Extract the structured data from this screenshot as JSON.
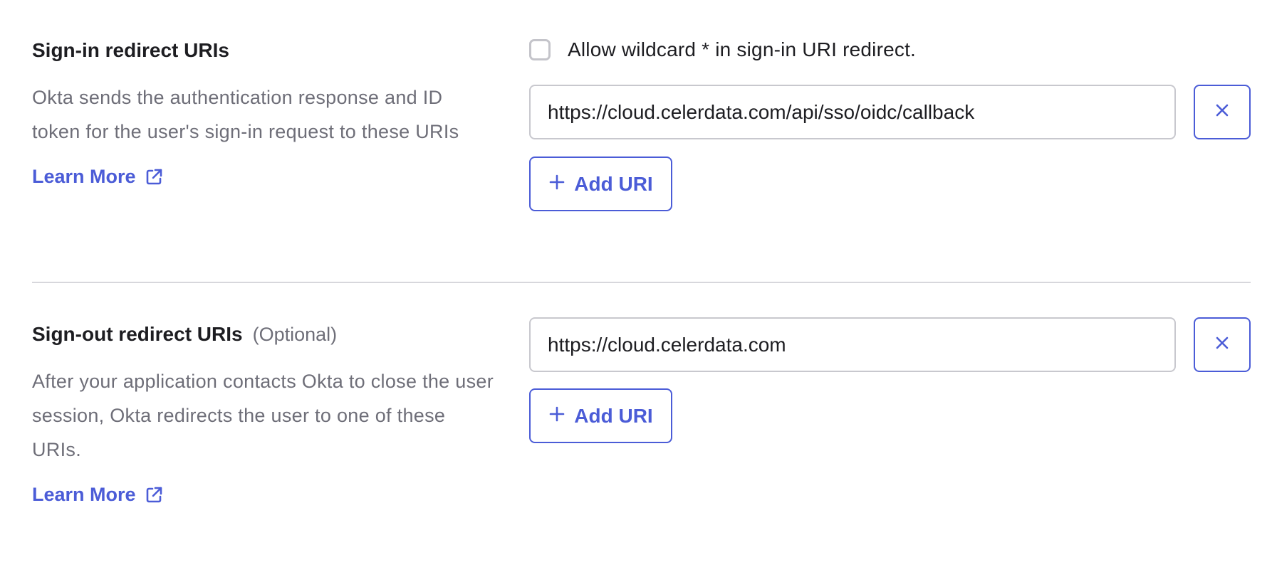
{
  "colors": {
    "accent": "#4b5cd7",
    "text_primary": "#1d1d21",
    "text_secondary": "#6e6e78",
    "border": "#c8c8ce",
    "divider": "#d7d7dc"
  },
  "signin": {
    "title": "Sign-in redirect URIs",
    "description": "Okta sends the authentication response and ID token for the user's sign-in request to these URIs",
    "learn_more": "Learn More",
    "learn_more_icon": "external-link-icon",
    "wildcard_checked": false,
    "wildcard_label": "Allow wildcard * in sign-in URI redirect.",
    "uris": [
      "https://cloud.celerdata.com/api/sso/oidc/callback"
    ],
    "remove_icon": "close-icon",
    "add_label": "Add URI",
    "add_icon": "plus-icon"
  },
  "signout": {
    "title": "Sign-out redirect URIs",
    "optional": "(Optional)",
    "description": "After your application contacts Okta to close the user session, Okta redirects the user to one of these URIs.",
    "learn_more": "Learn More",
    "learn_more_icon": "external-link-icon",
    "uris": [
      "https://cloud.celerdata.com"
    ],
    "remove_icon": "close-icon",
    "add_label": "Add URI",
    "add_icon": "plus-icon"
  }
}
